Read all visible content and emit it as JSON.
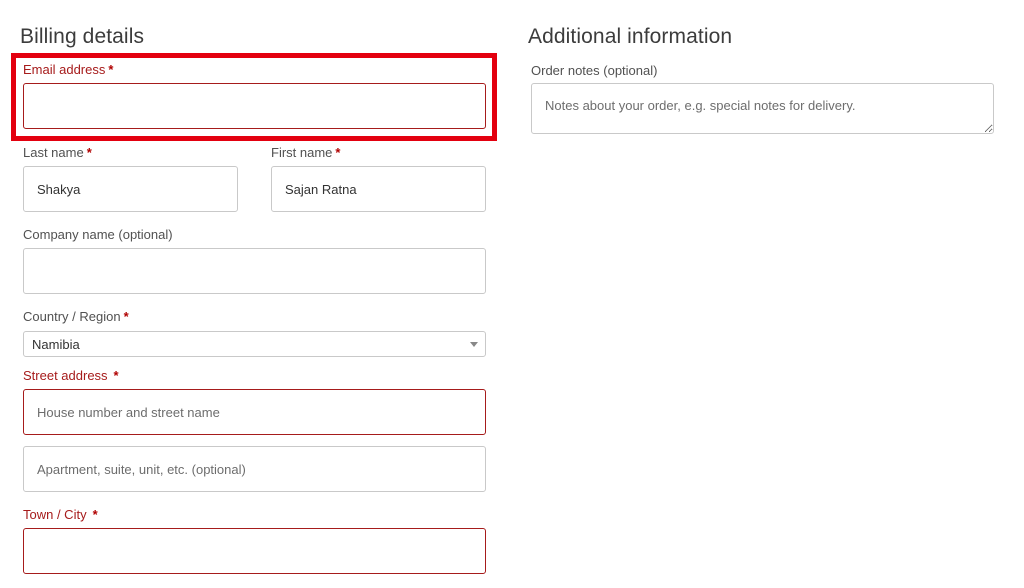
{
  "billing": {
    "heading": "Billing details",
    "email": {
      "label": "Email address",
      "required": "*",
      "value": "",
      "placeholder": ""
    },
    "last_name": {
      "label": "Last name",
      "required": "*",
      "value": "Shakya"
    },
    "first_name": {
      "label": "First name",
      "required": "*",
      "value": "Sajan Ratna"
    },
    "company": {
      "label": "Company name (optional)",
      "value": ""
    },
    "country": {
      "label": "Country / Region",
      "required": "*",
      "value": "Namibia"
    },
    "street": {
      "label": "Street address",
      "required": "*",
      "line1_placeholder": "House number and street name",
      "line2_placeholder": "Apartment, suite, unit, etc. (optional)"
    },
    "city": {
      "label": "Town / City",
      "required": "*",
      "value": ""
    }
  },
  "additional": {
    "heading": "Additional information",
    "notes": {
      "label": "Order notes (optional)",
      "placeholder": "Notes about your order, e.g. special notes for delivery."
    }
  },
  "colors": {
    "error": "#a61b1b",
    "highlight": "#e3000f",
    "border": "#c9c9c9"
  }
}
